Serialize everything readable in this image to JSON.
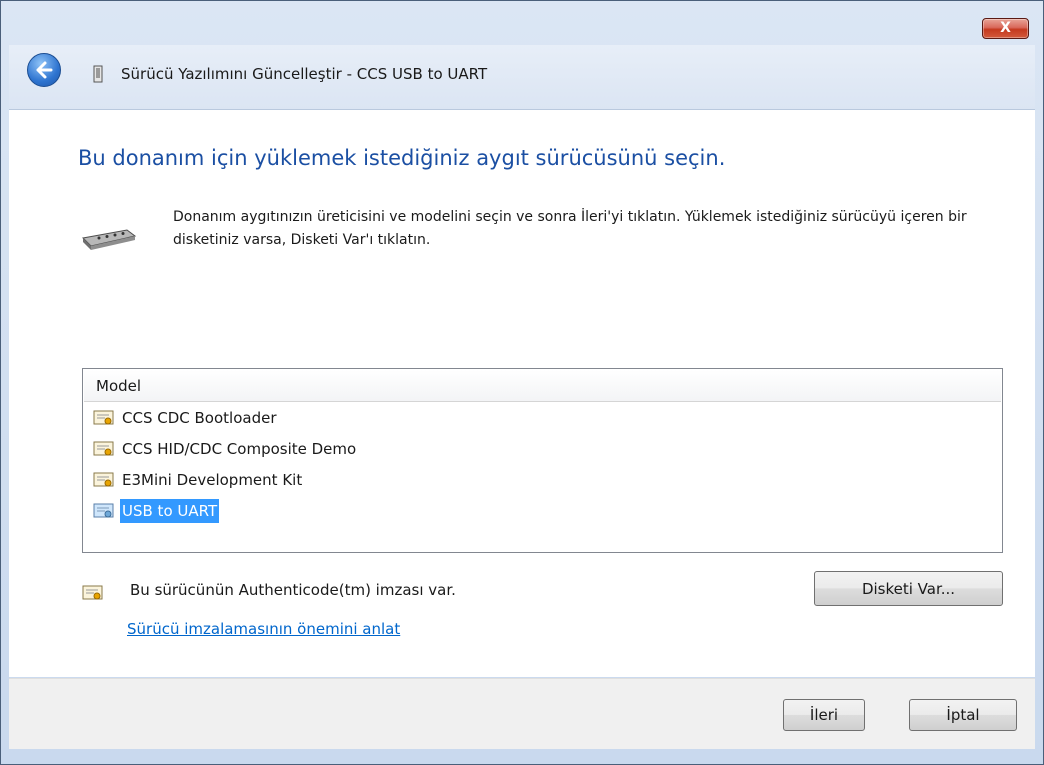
{
  "titlebar": {
    "close_label": "X"
  },
  "window": {
    "title": "Sürücü Yazılımını Güncelleştir - CCS USB to UART"
  },
  "content": {
    "heading": "Bu donanım için yüklemek istediğiniz aygıt sürücüsünü seçin.",
    "description": "Donanım aygıtınızın üreticisini ve modelini seçin ve sonra İleri'yi tıklatın. Yüklemek istediğiniz sürücüyü içeren bir disketiniz varsa, Disketi Var'ı tıklatın."
  },
  "list": {
    "header": "Model",
    "items": [
      {
        "label": "CCS CDC Bootloader",
        "selected": false
      },
      {
        "label": "CCS HID/CDC Composite Demo",
        "selected": false
      },
      {
        "label": "E3Mini Development Kit",
        "selected": false
      },
      {
        "label": "USB to UART",
        "selected": true
      }
    ],
    "selection_color": "#3399ff"
  },
  "auth": {
    "text": "Bu sürücünün Authenticode(tm) imzası var.",
    "link": "Sürücü imzalamasının önemini anlat"
  },
  "buttons": {
    "have_disk": "Disketi Var...",
    "next": "İleri",
    "cancel": "İptal"
  },
  "colors": {
    "heading": "#1b4fa3",
    "link": "#0066cc",
    "close_button": "#c4391e"
  }
}
